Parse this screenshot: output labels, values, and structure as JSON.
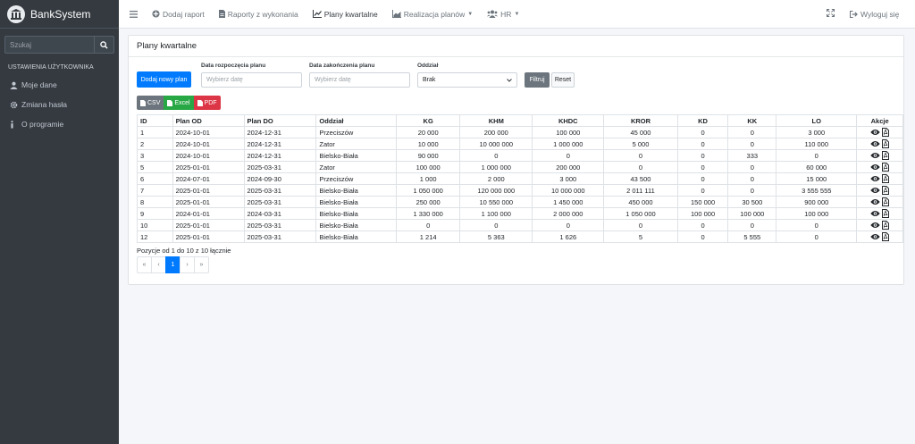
{
  "brand": {
    "name": "BankSystem"
  },
  "sidebar": {
    "search_placeholder": "Szukaj",
    "header": "USTAWIENIA UŻYTKOWNIKA",
    "items": [
      {
        "label": "Moje dane",
        "icon": "user-icon"
      },
      {
        "label": "Zmiana hasła",
        "icon": "gear-icon"
      },
      {
        "label": "O programie",
        "icon": "info-icon"
      }
    ]
  },
  "topnav": {
    "items": [
      {
        "label": "Dodaj raport",
        "icon": "plus-circle-icon"
      },
      {
        "label": "Raporty z wykonania",
        "icon": "document-icon"
      },
      {
        "label": "Plany kwartalne",
        "icon": "chart-line-icon"
      },
      {
        "label": "Realizacja planów",
        "icon": "chart-area-icon"
      },
      {
        "label": "HR",
        "icon": "users-icon"
      }
    ],
    "logout": "Wyloguj się"
  },
  "card": {
    "title": "Plany kwartalne"
  },
  "filters": {
    "add_button": "Dodaj nowy plan",
    "start_label": "Data rozpoczęcia planu",
    "start_placeholder": "Wybierz datę",
    "end_label": "Data zakończenia planu",
    "end_placeholder": "Wybierz datę",
    "branch_label": "Oddział",
    "branch_value": "Brak",
    "filter_button": "Filtruj",
    "reset_button": "Reset"
  },
  "exports": {
    "csv": "CSV",
    "excel": "Excel",
    "pdf": "PDF"
  },
  "colors": {
    "csv": "#6c757d",
    "excel": "#28a745",
    "pdf": "#dc3545",
    "primary": "#007bff",
    "sidebar": "#343a40"
  },
  "table": {
    "headers": [
      "ID",
      "Plan OD",
      "Plan DO",
      "Oddział",
      "KG",
      "KHM",
      "KHDC",
      "KROR",
      "KD",
      "KK",
      "LO",
      "Akcje"
    ],
    "rows": [
      [
        "1",
        "2024-10-01",
        "2024-12-31",
        "Przeciszów",
        "20 000",
        "200 000",
        "100 000",
        "45 000",
        "0",
        "0",
        "3 000"
      ],
      [
        "2",
        "2024-10-01",
        "2024-12-31",
        "Zator",
        "10 000",
        "10 000 000",
        "1 000 000",
        "5 000",
        "0",
        "0",
        "110 000"
      ],
      [
        "3",
        "2024-10-01",
        "2024-12-31",
        "Bielsko-Biała",
        "90 000",
        "0",
        "0",
        "0",
        "0",
        "333",
        "0"
      ],
      [
        "5",
        "2025-01-01",
        "2025-03-31",
        "Zator",
        "100 000",
        "1 000 000",
        "200 000",
        "0",
        "0",
        "0",
        "60 000"
      ],
      [
        "6",
        "2024-07-01",
        "2024-09-30",
        "Przeciszów",
        "1 000",
        "2 000",
        "3 000",
        "43 500",
        "0",
        "0",
        "15 000"
      ],
      [
        "7",
        "2025-01-01",
        "2025-03-31",
        "Bielsko-Biała",
        "1 050 000",
        "120 000 000",
        "10 000 000",
        "2 011 111",
        "0",
        "0",
        "3 555 555"
      ],
      [
        "8",
        "2025-01-01",
        "2025-03-31",
        "Bielsko-Biała",
        "250 000",
        "10 550 000",
        "1 450 000",
        "450 000",
        "150 000",
        "30 500",
        "900 000"
      ],
      [
        "9",
        "2024-01-01",
        "2024-03-31",
        "Bielsko-Biała",
        "1 330 000",
        "1 100 000",
        "2 000 000",
        "1 050 000",
        "100 000",
        "100 000",
        "100 000"
      ],
      [
        "10",
        "2025-01-01",
        "2025-03-31",
        "Bielsko-Biała",
        "0",
        "0",
        "0",
        "0",
        "0",
        "0",
        "0"
      ],
      [
        "12",
        "2025-01-01",
        "2025-03-31",
        "Bielsko-Biała",
        "1 214",
        "5 363",
        "1 626",
        "5",
        "0",
        "5 555",
        "0"
      ]
    ]
  },
  "footer": {
    "summary": "Pozycje od 1 do 10 z 10 łącznie"
  },
  "pagination": {
    "first": "«",
    "prev": "‹",
    "current": "1",
    "next": "›",
    "last": "»"
  }
}
